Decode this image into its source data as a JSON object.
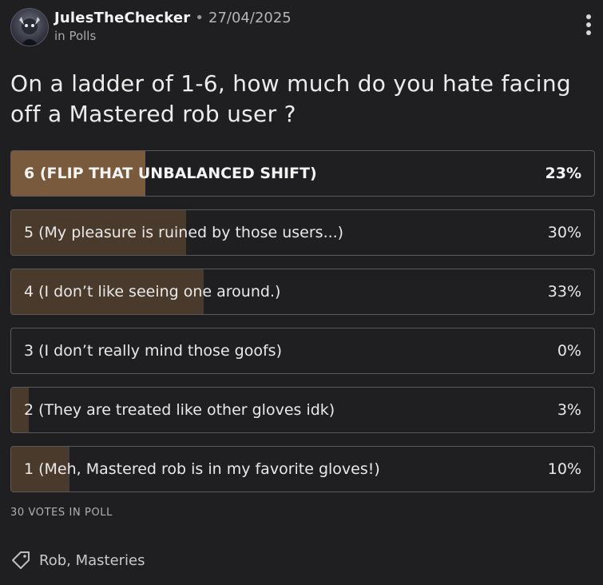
{
  "post": {
    "author": "JulesTheChecker",
    "separator": "•",
    "date": "27/04/2025",
    "community": "in Polls"
  },
  "question": "On a ladder of 1-6, how much do you hate facing off a Mastered rob user ?",
  "poll": {
    "options": [
      {
        "label": "6 (FLIP THAT UNBALANCED SHIFT)",
        "percent_text": "23%",
        "percent": 23,
        "leading": true
      },
      {
        "label": "5 (My pleasure is ruined by those users...)",
        "percent_text": "30%",
        "percent": 30,
        "leading": false
      },
      {
        "label": "4 (I don’t like seeing one around.)",
        "percent_text": "33%",
        "percent": 33,
        "leading": false
      },
      {
        "label": "3 (I don’t really mind those goofs)",
        "percent_text": "0%",
        "percent": 0,
        "leading": false
      },
      {
        "label": "2 (They are treated like other gloves idk)",
        "percent_text": "3%",
        "percent": 3,
        "leading": false
      },
      {
        "label": "1 (Meh, Mastered rob is in my favorite gloves!)",
        "percent_text": "10%",
        "percent": 10,
        "leading": false
      }
    ],
    "votes_text": "30 VOTES IN POLL"
  },
  "tags": {
    "icon": "tag-icon",
    "text": "Rob, Masteries"
  },
  "icons": {
    "more": "more-vertical-icon",
    "avatar": "avatar"
  },
  "colors": {
    "background": "#1f1f21",
    "leading_fill": "#7a5a3c",
    "fill": "#4a3a2c",
    "border": "#5a5a5d"
  }
}
